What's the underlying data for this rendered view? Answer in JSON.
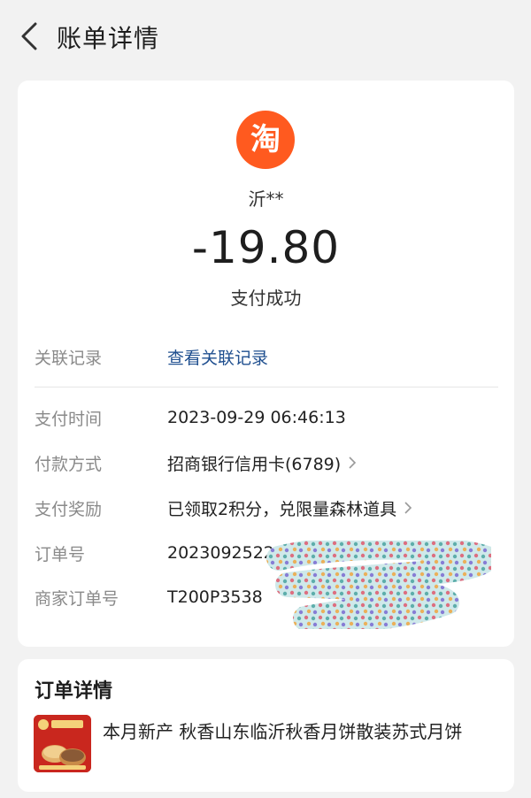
{
  "header": {
    "title": "账单详情",
    "back_icon": "chevron-left-icon"
  },
  "summary": {
    "merchant_logo_icon": "taobao-icon",
    "merchant_logo_text": "淘",
    "merchant_logo_color": "#ff5a1f",
    "merchant_name": "沂**",
    "amount": "-19.80",
    "status": "支付成功"
  },
  "details": {
    "related_records": {
      "label": "关联记录",
      "value": "查看关联记录"
    },
    "pay_time": {
      "label": "支付时间",
      "value": "2023-09-29 06:46:13"
    },
    "pay_method": {
      "label": "付款方式",
      "value": "招商银行信用卡(6789)"
    },
    "reward": {
      "label": "支付奖励",
      "value": "已领取2积分，兑限量森林道具"
    },
    "order_no": {
      "label": "订单号",
      "value": "20230925220"
    },
    "merchant_order_no": {
      "label": "商家订单号",
      "value": "T200P3538"
    }
  },
  "order": {
    "title": "订单详情",
    "product_title": "本月新产 秋香山东临沂秋香月饼散装苏式月饼"
  },
  "colors": {
    "link": "#1f4f8f",
    "label": "#8a8a8a"
  }
}
